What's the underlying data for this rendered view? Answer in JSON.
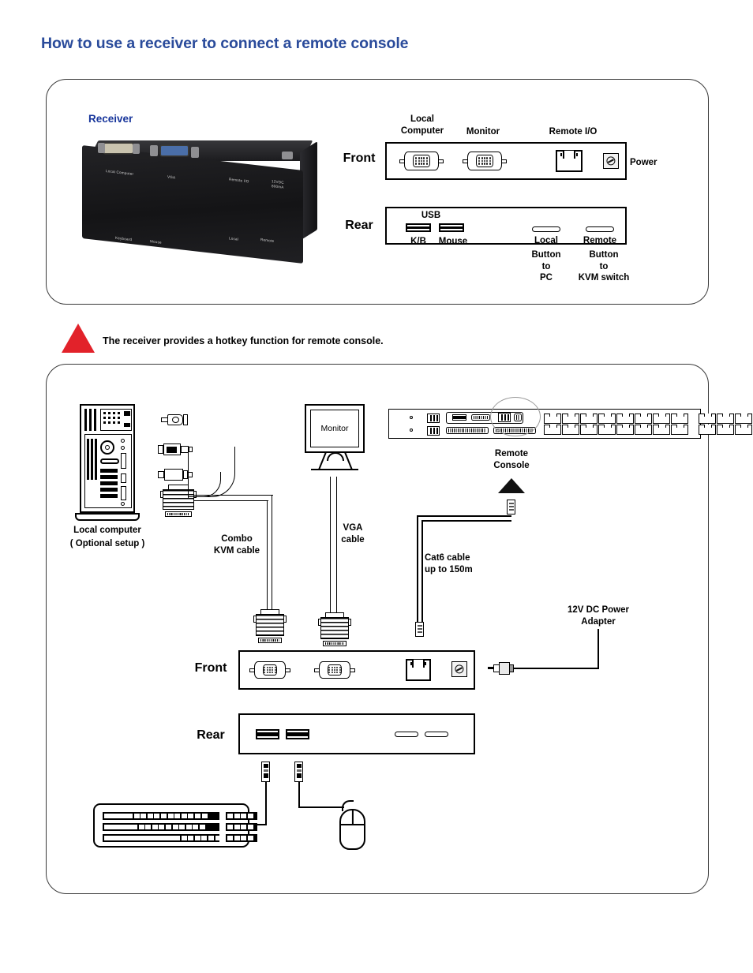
{
  "page": {
    "title": "How to use a receiver to connect a remote console",
    "title_color": "#2a4b9b"
  },
  "top_panel": {
    "section_label": "Receiver",
    "device_photo_labels": [
      "Local Computer",
      "VGA",
      "Remote I/O",
      "12VDC 800mA",
      "Keyboard",
      "Mouse",
      "Local",
      "Remote"
    ],
    "front": {
      "row_label": "Front",
      "port_labels": [
        "Local\nComputer",
        "Monitor",
        "Remote I/O"
      ],
      "power_label": "Power",
      "ports": [
        "vga-port",
        "vga-port",
        "rj45-port",
        "power-jack"
      ]
    },
    "rear": {
      "row_label": "Rear",
      "usb_group_label": "USB",
      "usb_ports": [
        "K/B",
        "Mouse"
      ],
      "buttons": [
        {
          "name": "Local",
          "caption": "Button\nto\nPC"
        },
        {
          "name": "Remote",
          "caption": "Button\nto\nKVM switch"
        }
      ]
    }
  },
  "note": {
    "icon": "warning-triangle-icon",
    "icon_color": "#e2222a",
    "text": "The receiver provides a hotkey function for remote console."
  },
  "bottom_panel": {
    "local_computer_label": "Local computer",
    "local_computer_sublabel": "( Optional setup )",
    "combo_cable_label": "Combo\nKVM cable",
    "monitor_label": "Monitor",
    "vga_cable_label": "VGA\ncable",
    "remote_console_label": "Remote\nConsole",
    "cat6_label": "Cat6 cable\nup to 150m",
    "power_adapter_label": "12V DC Power\nAdapter",
    "front": {
      "row_label": "Front",
      "ports": [
        "vga-port",
        "vga-port",
        "rj45-port",
        "power-jack"
      ]
    },
    "rear": {
      "row_label": "Rear",
      "ports": [
        "usb-port",
        "usb-port",
        "button",
        "button"
      ]
    },
    "kvm_switch": {
      "rj45_bank_count": 2,
      "rj45_ports_per_bank": 16
    },
    "peripherals": [
      "keyboard",
      "mouse"
    ]
  }
}
